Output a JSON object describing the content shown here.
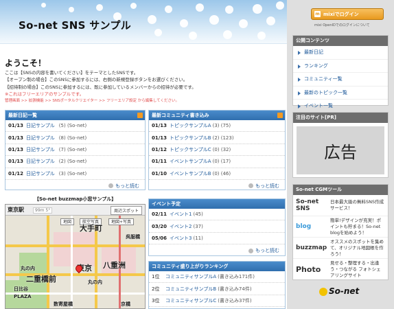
{
  "header": {
    "title": "So-net SNS サンプル"
  },
  "login": {
    "button_label": "mixiでログイン",
    "button_mark": "m",
    "note": "mixi OpenIDでのログインについて"
  },
  "welcome": {
    "title": "ようこそ！",
    "lines": [
      "ここは【SNSの内容を書いてください】をテーマとしたSNSです。",
      "【オープン制の場合】このSNSに参加するには、右側の新規登録ボタンをお選びください。",
      "【招待制の場合】このSNSに参加するには、既に参加しているメンバーからの招待が必要です。"
    ],
    "note": "※これはフリーエリアのサンプルです。",
    "links": "管理画面 >> 拡張機能 >> SNSポータルクリエイター >> フリーエリア設定 から編集してください。"
  },
  "diary": {
    "title": "最新日記一覧",
    "rows": [
      {
        "date": "01/13",
        "title": "日記サンプル",
        "count": "(5)",
        "user": "(So-net)"
      },
      {
        "date": "01/13",
        "title": "日記サンプル",
        "count": "(8)",
        "user": "(So-net)"
      },
      {
        "date": "01/13",
        "title": "日記サンプル",
        "count": "(7)",
        "user": "(So-net)"
      },
      {
        "date": "01/13",
        "title": "日記サンプル",
        "count": "(2)",
        "user": "(So-net)"
      },
      {
        "date": "01/12",
        "title": "日記サンプル",
        "count": "(3)",
        "user": "(So-net)"
      }
    ],
    "more": "もっと読む"
  },
  "community": {
    "title": "最新コミュニティ書き込み",
    "rows": [
      {
        "date": "01/13",
        "title": "トピックサンプルA",
        "count": "(3)",
        "user": "(75)"
      },
      {
        "date": "01/13",
        "title": "トピックサンプルB",
        "count": "(2)",
        "user": "(123)"
      },
      {
        "date": "01/12",
        "title": "トピックサンプルC",
        "count": "(0)",
        "user": "(32)"
      },
      {
        "date": "01/11",
        "title": "イベントサンプルA",
        "count": "(0)",
        "user": "(17)"
      },
      {
        "date": "01/10",
        "title": "イベントサンプルB",
        "count": "(0)",
        "user": "(46)"
      }
    ],
    "more": "もっと読む"
  },
  "events": {
    "title": "イベント予定",
    "rows": [
      {
        "date": "02/11",
        "title": "イベント1",
        "count": "(45)"
      },
      {
        "date": "03/20",
        "title": "イベント2",
        "count": "(37)"
      },
      {
        "date": "05/06",
        "title": "イベント3",
        "count": "(11)"
      }
    ],
    "more": "もっと読む"
  },
  "ranking": {
    "title": "コミュニティ盛り上がりランキング",
    "rows": [
      {
        "rank": "1位",
        "title": "コミュニティサンプルA",
        "count": "(書き込み171件)"
      },
      {
        "rank": "2位",
        "title": "コミュニティサンプルB",
        "count": "(書き込み74件)"
      },
      {
        "rank": "3位",
        "title": "コミュニティサンプルC",
        "count": "(書き込み37件)"
      }
    ]
  },
  "map": {
    "title": "【So-net buzzmap小窓サンプル】",
    "station": "東京駅",
    "zoom": "99m 5°",
    "search": "周辺スポット",
    "tabs": [
      "地図",
      "航空写真",
      "地図+写真"
    ],
    "labels": [
      "東京",
      "二重橋前",
      "丸の内",
      "八重洲",
      "大手町",
      "京橋",
      "日比谷",
      "丸の内",
      "PLAZA",
      "数寄屋橋",
      "呉服橋"
    ]
  },
  "public": {
    "title": "公開コンテンツ",
    "items": [
      "最新日記",
      "ランキング",
      "コミュニティ一覧",
      "最新のトピック一覧",
      "イベント一覧"
    ]
  },
  "featured": {
    "title": "注目のサイト[PR]",
    "ad": "広告"
  },
  "cgm": {
    "title": "So-net CGMツール",
    "rows": [
      {
        "logo": "So-net SNS",
        "text": "日本最大級の無料SNS作成サービス！"
      },
      {
        "logo": "blog",
        "text": "簡単!デザインが充実！ポイントも貯まる！So-net blogを始めよう！"
      },
      {
        "logo": "buzzmap",
        "text": "オススメのスポットを集めて、オリジナル地図帳を作ろう！"
      },
      {
        "logo": "Photo",
        "text": "見せる・整理する・出逢う・つながる フォトシェアリングサイト"
      }
    ]
  },
  "footer_logo": "So-net"
}
